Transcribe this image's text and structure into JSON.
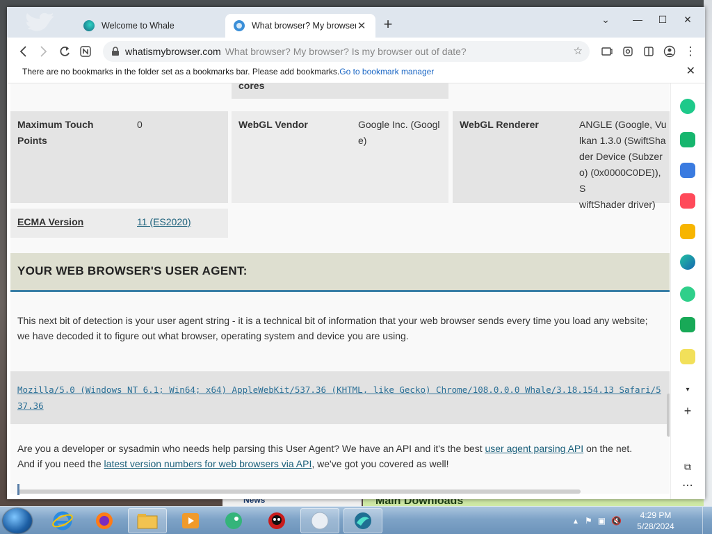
{
  "window": {
    "tabs": [
      {
        "title": "Welcome to Whale",
        "active": false
      },
      {
        "title": "What browser? My browser? Is",
        "active": true
      }
    ],
    "new_tab": "+",
    "controls": {
      "min": "⌄",
      "minimize": "—",
      "maximize": "☐",
      "close": "✕"
    }
  },
  "toolbar": {
    "domain": "whatismybrowser.com",
    "page_title": "What browser? My browser? Is my browser out of date?"
  },
  "bookmarks_bar": {
    "message": "There are no bookmarks in the folder set as a bookmarks bar. Please add bookmarks.",
    "link": "Go to bookmark manager",
    "close": "✕"
  },
  "page": {
    "cores_text": "cores",
    "cells": {
      "max_touch_label_1": "Maximum Touch",
      "max_touch_label_2": "Points",
      "max_touch_value": "0",
      "webgl_vendor_label": "WebGL Vendor",
      "webgl_vendor_value_1": "Google Inc. (Googl",
      "webgl_vendor_value_2": "e)",
      "webgl_renderer_label": "WebGL Renderer",
      "webgl_renderer_value_lines": [
        "ANGLE (Google, Vu",
        "lkan 1.3.0 (SwiftSha",
        "der Device (Subzer",
        "o) (0x0000C0DE)), S",
        "wiftShader driver)"
      ],
      "ecma_label": "ECMA Version",
      "ecma_value": "11 (ES2020)"
    },
    "ua_heading": "YOUR WEB BROWSER'S USER AGENT:",
    "ua_intro": "This next bit of detection is your user agent string - it is a technical bit of information that your web browser sends every time you load any website; we have decoded it to figure out what browser, operating system and device you are using.",
    "ua_string": "Mozilla/5.0 (Windows NT 6.1; Win64; x64) AppleWebKit/537.36 (KHTML, like Gecko) Chrome/108.0.0.0 Whale/3.18.154.13 Safari/537.36",
    "dev_text_1": "Are you a developer or sysadmin who needs help parsing this User Agent? We have an API and it's the best ",
    "dev_link_1": "user agent parsing API",
    "dev_text_2": " on the net.",
    "dev_text_3": "And if you need the ",
    "dev_link_2": "latest version numbers for web browsers via API",
    "dev_text_4": ", we've got you covered as well!"
  },
  "background": {
    "news": "News",
    "main_downloads": "Main Downloads"
  },
  "taskbar": {
    "time": "4:29 PM",
    "date": "5/28/2024"
  },
  "colors": {
    "heading_border": "#3a7fa6",
    "heading_bg": "#dedfd0",
    "link": "#1a5f7a"
  }
}
